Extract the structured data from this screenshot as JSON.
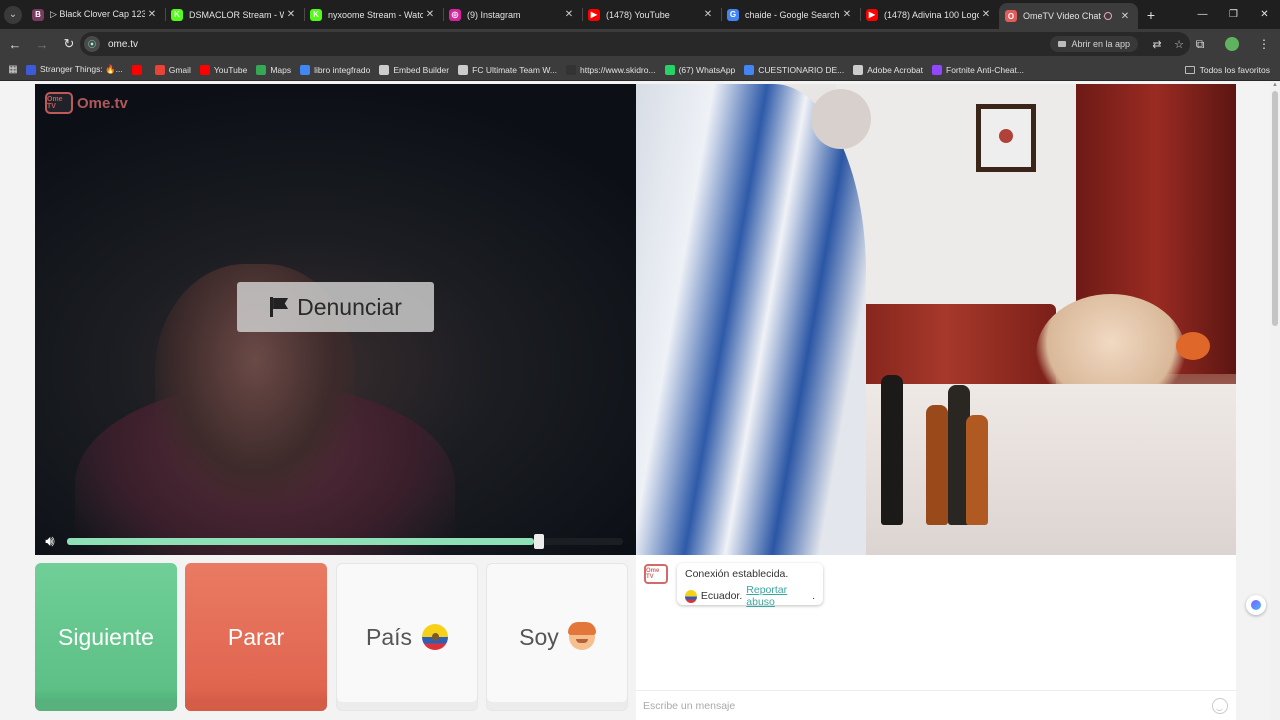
{
  "browser": {
    "tabs": [
      {
        "title": "▷ Black Clover Cap 123 [",
        "color": "#7a3b5e",
        "glyph": "B",
        "active": false
      },
      {
        "title": "DSMACLOR Stream - Wat",
        "color": "#53fc18",
        "glyph": "K",
        "active": false
      },
      {
        "title": "nyxoome Stream - Watch",
        "color": "#53fc18",
        "glyph": "K",
        "active": false
      },
      {
        "title": "(9) Instagram",
        "color": "#d6249f",
        "glyph": "◎",
        "active": false
      },
      {
        "title": "(1478) YouTube",
        "color": "#ff0000",
        "glyph": "▶",
        "active": false
      },
      {
        "title": "chaide - Google Search",
        "color": "#4285f4",
        "glyph": "G",
        "active": false
      },
      {
        "title": "(1478) Adivina 100 Logos",
        "color": "#ff0000",
        "glyph": "▶",
        "active": false
      },
      {
        "title": "OmeTV Video Chat -",
        "color": "#e35b5b",
        "glyph": "O",
        "active": true
      }
    ],
    "url": "ome.tv",
    "open_in_app": "Abrir en la app",
    "bookmarks": [
      {
        "label": "Stranger Things: 🔥...",
        "color": "#3b5bdb"
      },
      {
        "label": "",
        "color": "#ff0000"
      },
      {
        "label": "Gmail",
        "color": "#ea4335"
      },
      {
        "label": "YouTube",
        "color": "#ff0000"
      },
      {
        "label": "Maps",
        "color": "#34a853"
      },
      {
        "label": "libro integfrado",
        "color": "#4285f4"
      },
      {
        "label": "Embed Builder",
        "color": "#cccccc"
      },
      {
        "label": "FC Ultimate Team W...",
        "color": "#cccccc"
      },
      {
        "label": "https://www.skidro...",
        "color": "#333333"
      },
      {
        "label": "(67) WhatsApp",
        "color": "#25d366"
      },
      {
        "label": "CUESTIONARIO DE...",
        "color": "#4285f4"
      },
      {
        "label": "Adobe Acrobat",
        "color": "#cccccc"
      },
      {
        "label": "Fortnite Anti-Cheat...",
        "color": "#9146ff"
      }
    ],
    "all_bookmarks": "Todos los favoritos"
  },
  "app": {
    "logo_name": "Ome.tv",
    "logo_badge": "Ome TV",
    "report_label": "Denunciar",
    "volume_level": 0.84
  },
  "controls": {
    "next_label": "Siguiente",
    "stop_label": "Parar",
    "country_label": "País",
    "gender_label": "Soy"
  },
  "chat": {
    "badge": "Ome TV",
    "status": "Conexión establecida.",
    "country": "Ecuador.",
    "report_link": "Reportar abuso",
    "report_suffix": ".",
    "input_placeholder": "Escribe un mensaje"
  }
}
